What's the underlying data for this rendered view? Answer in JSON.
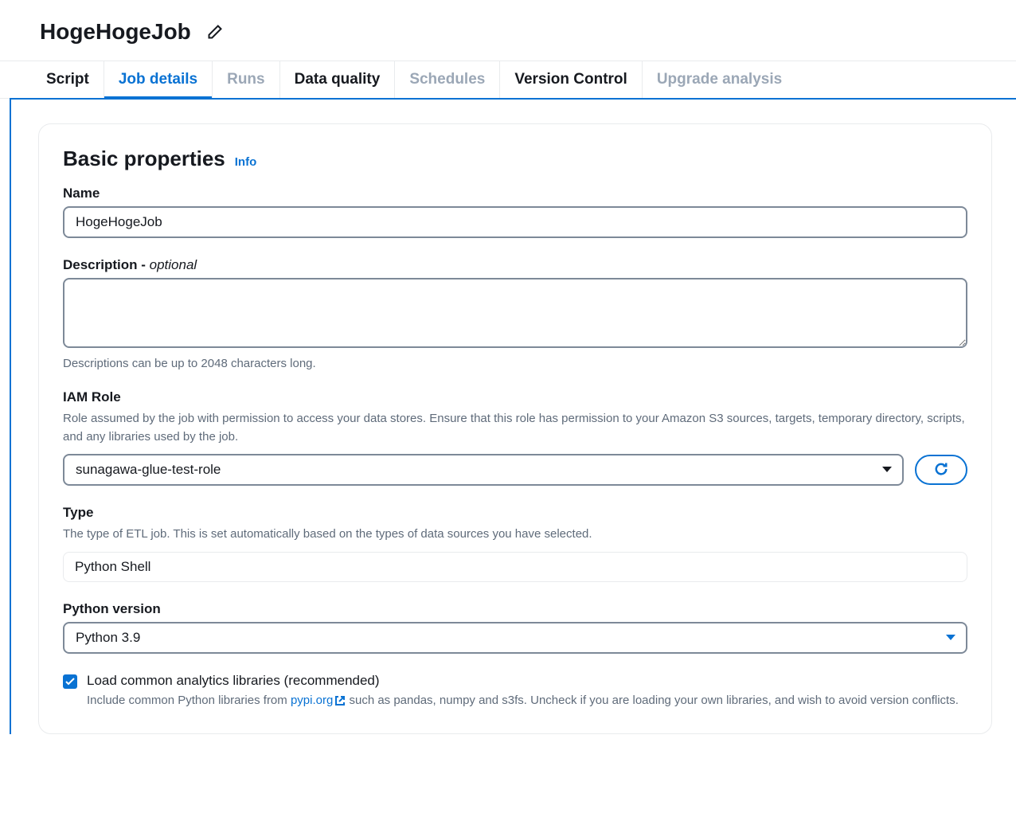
{
  "header": {
    "title": "HogeHogeJob"
  },
  "tabs": [
    {
      "label": "Script",
      "state": "default"
    },
    {
      "label": "Job details",
      "state": "active"
    },
    {
      "label": "Runs",
      "state": "disabled"
    },
    {
      "label": "Data quality",
      "state": "default"
    },
    {
      "label": "Schedules",
      "state": "disabled"
    },
    {
      "label": "Version Control",
      "state": "default"
    },
    {
      "label": "Upgrade analysis",
      "state": "disabled"
    }
  ],
  "panel": {
    "title": "Basic properties",
    "info_link": "Info"
  },
  "form": {
    "name": {
      "label": "Name",
      "value": "HogeHogeJob"
    },
    "description": {
      "label": "Description - ",
      "optional": "optional",
      "value": "",
      "help": "Descriptions can be up to 2048 characters long."
    },
    "iam_role": {
      "label": "IAM Role",
      "description": "Role assumed by the job with permission to access your data stores. Ensure that this role has permission to your Amazon S3 sources, targets, temporary directory, scripts, and any libraries used by the job.",
      "value": "sunagawa-glue-test-role"
    },
    "type": {
      "label": "Type",
      "description": "The type of ETL job. This is set automatically based on the types of data sources you have selected.",
      "value": "Python Shell"
    },
    "python_version": {
      "label": "Python version",
      "value": "Python 3.9"
    },
    "load_libs": {
      "checked": true,
      "label": "Load common analytics libraries (recommended)",
      "desc_prefix": "Include common Python libraries from ",
      "link_text": "pypi.org",
      "desc_suffix": " such as pandas, numpy and s3fs. Uncheck if you are loading your own libraries, and wish to avoid version conflicts."
    }
  }
}
